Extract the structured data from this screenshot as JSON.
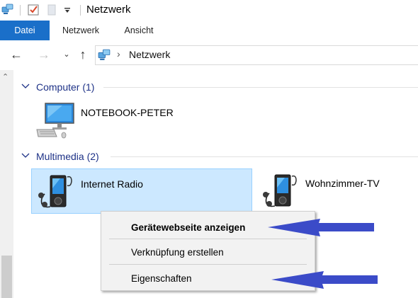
{
  "window": {
    "title": "Netzwerk"
  },
  "ribbon": {
    "tabs": [
      "Datei",
      "Netzwerk",
      "Ansicht"
    ]
  },
  "address_bar": {
    "location": "Netzwerk"
  },
  "groups": [
    {
      "label": "Computer (1)",
      "items": [
        {
          "name": "NOTEBOOK-PETER",
          "icon": "desktop-computer-icon"
        }
      ]
    },
    {
      "label": "Multimedia (2)",
      "items": [
        {
          "name": "Internet Radio",
          "icon": "media-player-icon",
          "selected": true
        },
        {
          "name": "Wohnzimmer-TV",
          "icon": "media-player-icon",
          "selected": false
        }
      ]
    }
  ],
  "context_menu": {
    "items": [
      {
        "label": "Gerätewebseite anzeigen",
        "bold": true
      },
      {
        "label": "Verknüpfung erstellen",
        "bold": false
      },
      {
        "label": "Eigenschaften",
        "bold": false
      }
    ]
  },
  "colors": {
    "accent": "#1a6fc9",
    "group_header": "#1e3287",
    "selection_bg": "#cce8ff",
    "selection_border": "#99d1ff",
    "annotation_arrow": "#3b4bc8"
  }
}
